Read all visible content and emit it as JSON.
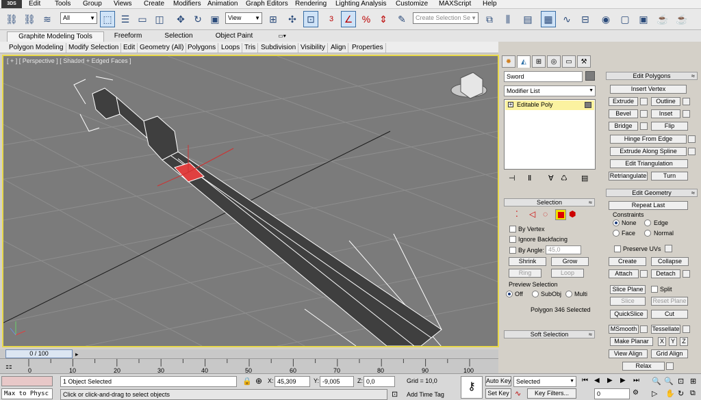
{
  "menubar": {
    "logo": "3DS",
    "items": [
      "Edit",
      "Tools",
      "Group",
      "Views",
      "Create",
      "Modifiers",
      "Animation",
      "Graph Editors",
      "Rendering",
      "Lighting Analysis",
      "Customize",
      "MAXScript",
      "Help"
    ]
  },
  "toolbar": {
    "selection_filter": "All",
    "ref_coord": "View",
    "named_selection_placeholder": "Create Selection Se",
    "snap_label": "3"
  },
  "ribbon": {
    "tabs": [
      "Graphite Modeling Tools",
      "Freeform",
      "Selection",
      "Object Paint"
    ],
    "subtabs": [
      "Polygon Modeling",
      "Modify Selection",
      "Edit",
      "Geometry (All)",
      "Polygons",
      "Loops",
      "Tris",
      "Subdivision",
      "Visibility",
      "Align",
      "Properties"
    ]
  },
  "viewport": {
    "label": "[ + ] [ Perspective ] [ Shaded + Edged Faces ]"
  },
  "timeline": {
    "frame_display": "0 / 100",
    "ticks": [
      "0",
      "10",
      "20",
      "30",
      "40",
      "50",
      "60",
      "70",
      "80",
      "90",
      "100"
    ]
  },
  "status": {
    "maxscript": "Max to Physc",
    "objects_selected": "1 Object Selected",
    "prompt": "Click or click-and-drag to select objects",
    "x_label": "X:",
    "x_value": "45,309",
    "y_label": "Y:",
    "y_value": "-9,005",
    "z_label": "Z:",
    "z_value": "0,0",
    "grid": "Grid = 10,0",
    "add_time_tag": "Add Time Tag",
    "auto_key": "Auto Key",
    "set_key": "Set Key",
    "key_mode": "Selected",
    "key_filters": "Key Filters...",
    "frame_field": "0"
  },
  "command_panel": {
    "object_name": "Sword",
    "modifier_list": "Modifier List",
    "stack_item": "Editable Poly",
    "selection": {
      "title": "Selection",
      "by_vertex": "By Vertex",
      "ignore_backfacing": "Ignore Backfacing",
      "by_angle": "By Angle:",
      "angle_value": "45,0",
      "shrink": "Shrink",
      "grow": "Grow",
      "ring": "Ring",
      "loop": "Loop",
      "preview_title": "Preview Selection",
      "off": "Off",
      "subobj": "SubObj",
      "multi": "Multi",
      "status": "Polygon 346 Selected"
    },
    "soft_selection": "Soft Selection"
  },
  "edit_polygons": {
    "title": "Edit Polygons",
    "insert_vertex": "Insert Vertex",
    "extrude": "Extrude",
    "outline": "Outline",
    "bevel": "Bevel",
    "inset": "Inset",
    "bridge": "Bridge",
    "flip": "Flip",
    "hinge": "Hinge From Edge",
    "extrude_spline": "Extrude Along Spline",
    "edit_tri": "Edit Triangulation",
    "retriangulate": "Retriangulate",
    "turn": "Turn"
  },
  "edit_geometry": {
    "title": "Edit Geometry",
    "repeat_last": "Repeat Last",
    "constraints": "Constraints",
    "none": "None",
    "edge": "Edge",
    "face": "Face",
    "normal": "Normal",
    "preserve_uvs": "Preserve UVs",
    "create": "Create",
    "collapse": "Collapse",
    "attach": "Attach",
    "detach": "Detach",
    "slice_plane": "Slice Plane",
    "split": "Split",
    "slice": "Slice",
    "reset_plane": "Reset Plane",
    "quickslice": "QuickSlice",
    "cut": "Cut",
    "msmooth": "MSmooth",
    "tessellate": "Tessellate",
    "make_planar": "Make Planar",
    "x": "X",
    "y": "Y",
    "z": "Z",
    "view_align": "View Align",
    "grid_align": "Grid Align",
    "relax": "Relax"
  }
}
